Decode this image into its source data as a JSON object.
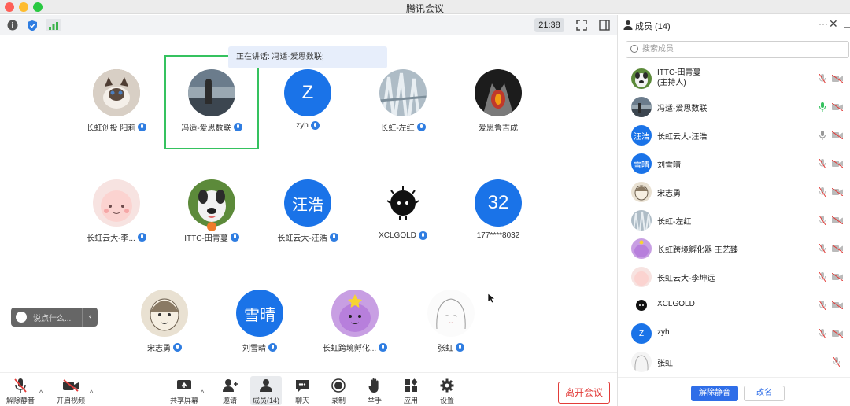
{
  "window": {
    "title": "腾讯会议"
  },
  "infobar": {
    "clock": "21:38"
  },
  "stage": {
    "speaking_label": "正在讲话: 冯适-爱思数联;",
    "chat_placeholder": "说点什么...",
    "tiles": [
      {
        "name": "长虹创投 阳莉",
        "avatar_text": ""
      },
      {
        "name": "冯适-爱思数联",
        "avatar_text": ""
      },
      {
        "name": "zyh",
        "avatar_text": "Z"
      },
      {
        "name": "长虹-左红",
        "avatar_text": ""
      },
      {
        "name": "爱思鲁吉成",
        "avatar_text": ""
      },
      {
        "name": "长虹云大-李...",
        "avatar_text": ""
      },
      {
        "name": "ITTC-田青蔓",
        "avatar_text": ""
      },
      {
        "name": "长虹云大-汪浩",
        "avatar_text": "汪浩"
      },
      {
        "name": "XCLGOLD",
        "avatar_text": ""
      },
      {
        "name": "177****8032",
        "avatar_text": "32"
      },
      {
        "name": "宋志勇",
        "avatar_text": ""
      },
      {
        "name": "刘雪晴",
        "avatar_text": "雪晴"
      },
      {
        "name": "长虹跨境孵化...",
        "avatar_text": ""
      },
      {
        "name": "张虹",
        "avatar_text": ""
      }
    ]
  },
  "toolbar": {
    "unmute": "解除静音",
    "start_video": "开启视频",
    "share_screen": "共享屏幕",
    "invite": "邀请",
    "members": "成员(14)",
    "chat": "聊天",
    "record": "录制",
    "raise_hand": "举手",
    "apps": "应用",
    "settings": "设置",
    "leave": "离开会议"
  },
  "panel": {
    "title": "成员 (14)",
    "search_placeholder": "搜索成员",
    "members": [
      {
        "name": "ITTC-田青蔓",
        "role": "(主持人)",
        "avatar_text": ""
      },
      {
        "name": "冯适-爱思数联",
        "role": "",
        "avatar_text": ""
      },
      {
        "name": "长虹云大-汪浩",
        "role": "",
        "avatar_text": "汪浩"
      },
      {
        "name": "刘雪晴",
        "role": "",
        "avatar_text": "雪晴"
      },
      {
        "name": "宋志勇",
        "role": "",
        "avatar_text": ""
      },
      {
        "name": "长虹-左红",
        "role": "",
        "avatar_text": ""
      },
      {
        "name": "长虹跨境孵化器 王艺臻",
        "role": "",
        "avatar_text": ""
      },
      {
        "name": "长虹云大-李坤远",
        "role": "",
        "avatar_text": ""
      },
      {
        "name": "XCLGOLD",
        "role": "",
        "avatar_text": ""
      },
      {
        "name": "zyh",
        "role": "",
        "avatar_text": "Z"
      },
      {
        "name": "张虹",
        "role": "",
        "avatar_text": ""
      }
    ],
    "unmute_all": "解除静音",
    "rename": "改名"
  },
  "colors": {
    "accent": "#2f6ee8",
    "speaking_border": "#35c25f",
    "leave": "#e23c39",
    "avatar_blue": "#1a73e8"
  }
}
